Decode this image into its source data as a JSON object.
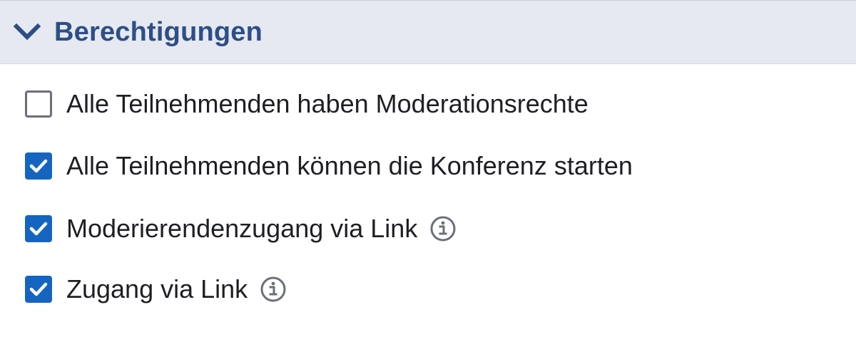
{
  "section": {
    "title": "Berechtigungen",
    "expanded": true,
    "header_color": "#2d4f86",
    "header_background": "#e6e9f1"
  },
  "options": [
    {
      "label": "Alle Teilnehmenden haben Moderationsrechte",
      "checked": false,
      "info_icon": false
    },
    {
      "label": "Alle Teilnehmenden können die Konferenz starten",
      "checked": true,
      "info_icon": false
    },
    {
      "label": "Moderierendenzugang via Link",
      "checked": true,
      "info_icon": true
    },
    {
      "label": "Zugang via Link",
      "checked": true,
      "info_icon": true
    }
  ],
  "colors": {
    "checkbox_checked": "#1565c0",
    "checkbox_unchecked_border": "#6b6f78",
    "label_text": "#1e1f23",
    "info_icon": "#6b6f78"
  }
}
